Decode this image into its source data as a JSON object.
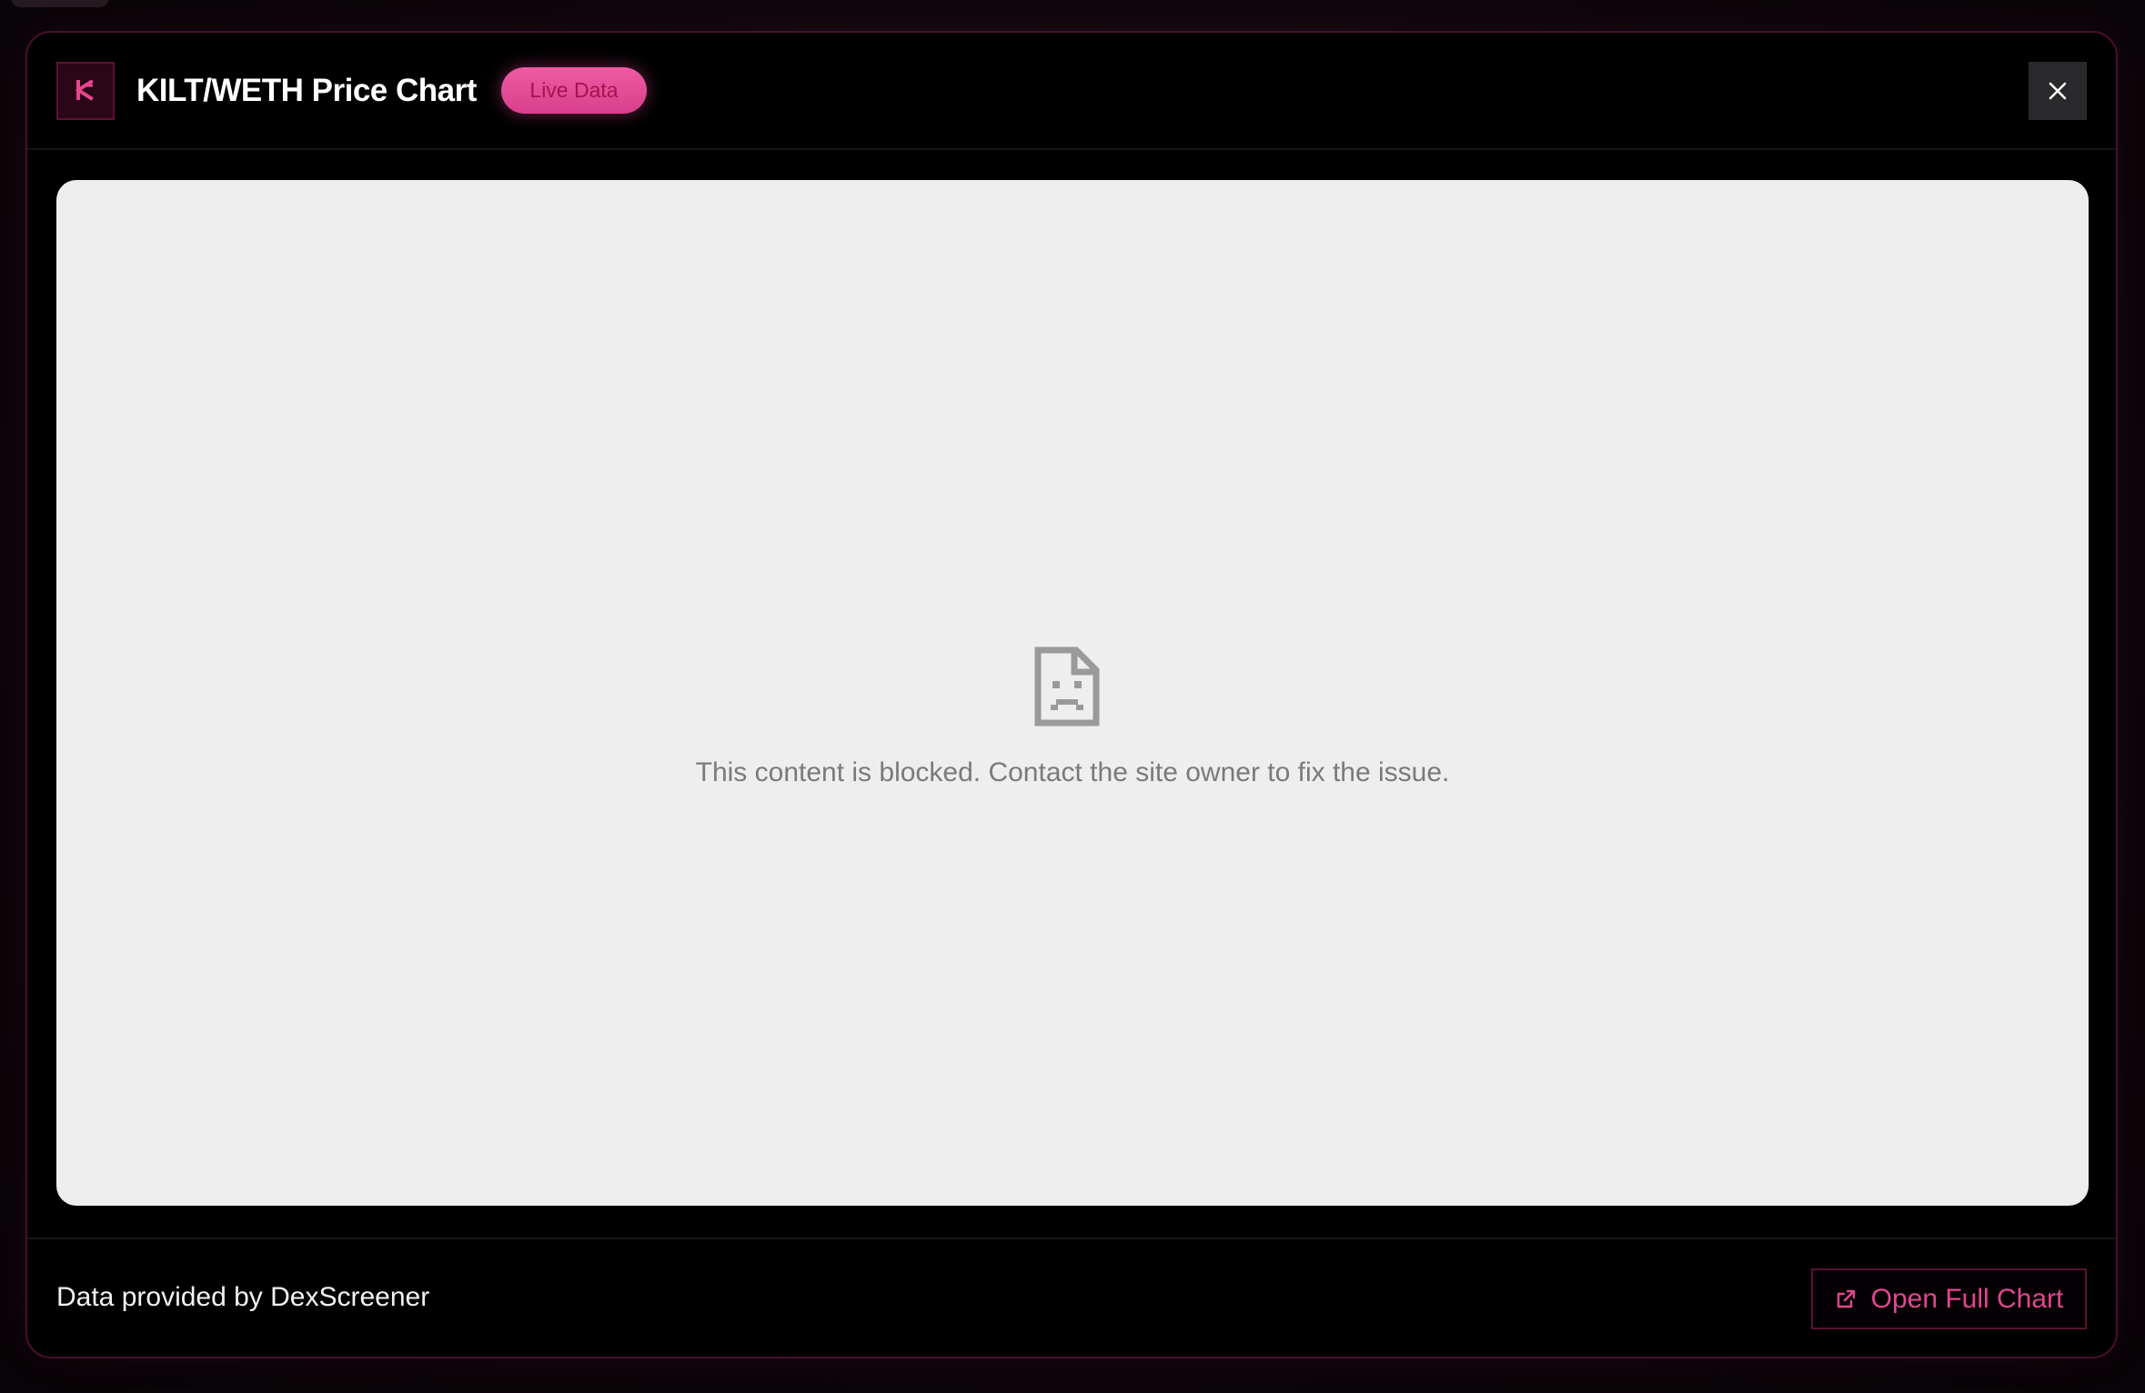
{
  "modal": {
    "title": "KILT/WETH Price Chart",
    "badge": "Live Data",
    "close_icon": "close-icon",
    "logo_icon": "kilt-logo-icon"
  },
  "chart_frame": {
    "blocked_message": "This content is blocked. Contact the site owner to fix the issue.",
    "icon": "blocked-page-icon"
  },
  "footer": {
    "attribution": "Data provided by DexScreener",
    "open_button_label": "Open Full Chart",
    "open_button_icon": "external-link-icon"
  },
  "colors": {
    "accent": "#e2468f",
    "badge_bg": "#e04f97",
    "border": "#4a0f2c",
    "frame_bg": "#eeeeee"
  }
}
